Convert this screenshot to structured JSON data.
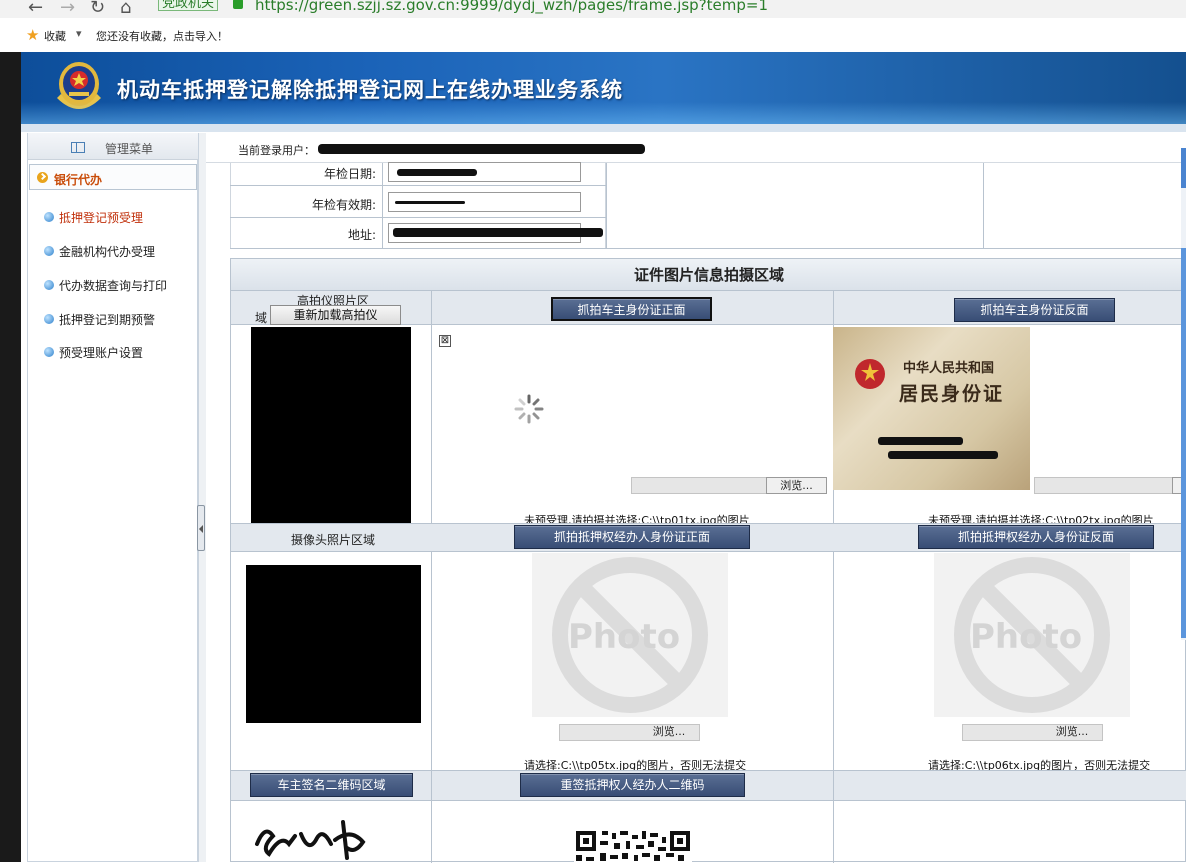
{
  "browser": {
    "site_tag": "党政机关",
    "url": "https://green.szjj.sz.gov.cn:9999/dydj_wzh/pages/frame.jsp?temp=1"
  },
  "bookmarks": {
    "favorites_label": "收藏",
    "favorites_dropdown": "▾",
    "import_hint": "您还没有收藏，点击导入！"
  },
  "banner": {
    "title": "机动车抵押登记解除抵押登记网上在线办理业务系统"
  },
  "sidebar": {
    "title": "管理菜单",
    "section": "银行代办",
    "items": [
      {
        "label": "抵押登记预受理",
        "active": true
      },
      {
        "label": "金融机构代办受理",
        "active": false
      },
      {
        "label": "代办数据查询与打印",
        "active": false
      },
      {
        "label": "抵押登记到期预警",
        "active": false
      },
      {
        "label": "预受理账户设置",
        "active": false
      }
    ]
  },
  "user_bar": {
    "label": "当前登录用户："
  },
  "vehicle_info": {
    "inspect_date_label": "年检日期:",
    "inspect_valid_label": "年检有效期:",
    "address_label": "地址:"
  },
  "photo_panel": {
    "title": "证件图片信息拍摄区域",
    "row1": {
      "scanner_area_label": "高拍仪照片区",
      "scanner_area_suffix": "域",
      "reload_button": "重新加载高拍仪",
      "front_button": "抓拍车主身份证正面",
      "back_button": "抓拍车主身份证反面",
      "browse_button": "浏览...",
      "front_caption": "未预受理,请拍摄并选择:C:\\\\tp01tx.jpg的图片",
      "back_caption": "未预受理,请拍摄并选择:C:\\\\tp02tx.jpg的图片",
      "id_card_title1": "中华人民共和国",
      "id_card_title2": "居民身份证"
    },
    "row2": {
      "camera_area_label": "摄像头照片区域",
      "agent_front_button": "抓拍抵押权经办人身份证正面",
      "agent_back_button": "抓拍抵押权经办人身份证反面",
      "browse_button": "浏览...",
      "photo_placeholder": "Photo",
      "front_caption": "请选择:C:\\\\tp05tx.jpg的图片，否则无法提交",
      "back_caption": "请选择:C:\\\\tp06tx.jpg的图片，否则无法提交"
    },
    "row3": {
      "owner_qr_button": "车主签名二维码区域",
      "agent_qr_button": "重签抵押权人经办人二维码"
    }
  },
  "colors": {
    "banner": "#1b63b8",
    "accent_orange": "#c94c09",
    "button_blue": "#384d75"
  }
}
